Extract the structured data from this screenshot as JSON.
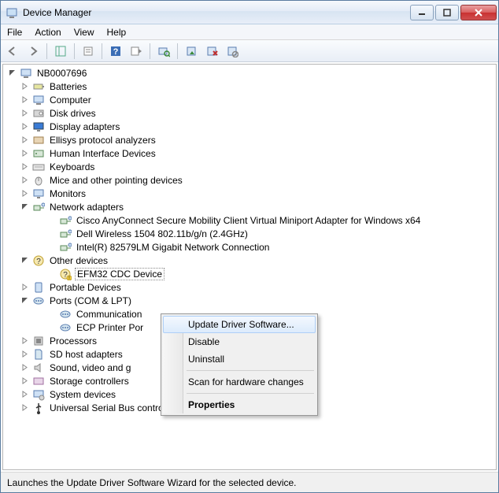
{
  "title": "Device Manager",
  "menubar": [
    "File",
    "Action",
    "View",
    "Help"
  ],
  "statusbar": "Launches the Update Driver Software Wizard for the selected device.",
  "root": "NB0007696",
  "categories": [
    {
      "label": "Batteries",
      "expanded": false,
      "hasChildren": true,
      "icon": "battery"
    },
    {
      "label": "Computer",
      "expanded": false,
      "hasChildren": true,
      "icon": "computer"
    },
    {
      "label": "Disk drives",
      "expanded": false,
      "hasChildren": true,
      "icon": "disk"
    },
    {
      "label": "Display adapters",
      "expanded": false,
      "hasChildren": true,
      "icon": "display"
    },
    {
      "label": "Ellisys protocol analyzers",
      "expanded": false,
      "hasChildren": true,
      "icon": "analyzer"
    },
    {
      "label": "Human Interface Devices",
      "expanded": false,
      "hasChildren": true,
      "icon": "hid"
    },
    {
      "label": "Keyboards",
      "expanded": false,
      "hasChildren": true,
      "icon": "keyboard"
    },
    {
      "label": "Mice and other pointing devices",
      "expanded": false,
      "hasChildren": true,
      "icon": "mouse"
    },
    {
      "label": "Monitors",
      "expanded": false,
      "hasChildren": true,
      "icon": "monitor"
    },
    {
      "label": "Network adapters",
      "expanded": true,
      "hasChildren": true,
      "icon": "network",
      "children": [
        {
          "label": "Cisco AnyConnect Secure Mobility Client Virtual Miniport Adapter for Windows x64",
          "icon": "network"
        },
        {
          "label": "Dell Wireless 1504 802.11b/g/n (2.4GHz)",
          "icon": "network"
        },
        {
          "label": "Intel(R) 82579LM Gigabit Network Connection",
          "icon": "network"
        }
      ]
    },
    {
      "label": "Other devices",
      "expanded": true,
      "hasChildren": true,
      "icon": "other",
      "children": [
        {
          "label": "EFM32 CDC Device",
          "icon": "unknown",
          "selected": true
        }
      ]
    },
    {
      "label": "Portable Devices",
      "expanded": false,
      "hasChildren": true,
      "icon": "portable"
    },
    {
      "label": "Ports (COM & LPT)",
      "expanded": true,
      "hasChildren": true,
      "icon": "port",
      "children": [
        {
          "label": "Communication",
          "icon": "port",
          "truncated": true
        },
        {
          "label": "ECP Printer Por",
          "icon": "port",
          "truncated": true
        }
      ]
    },
    {
      "label": "Processors",
      "expanded": false,
      "hasChildren": true,
      "icon": "cpu"
    },
    {
      "label": "SD host adapters",
      "expanded": false,
      "hasChildren": true,
      "icon": "sd"
    },
    {
      "label": "Sound, video and g",
      "expanded": false,
      "hasChildren": true,
      "icon": "sound",
      "truncated": true
    },
    {
      "label": "Storage controllers",
      "expanded": false,
      "hasChildren": true,
      "icon": "storage"
    },
    {
      "label": "System devices",
      "expanded": false,
      "hasChildren": true,
      "icon": "system"
    },
    {
      "label": "Universal Serial Bus controllers",
      "expanded": false,
      "hasChildren": true,
      "icon": "usb"
    }
  ],
  "context_menu": {
    "items": [
      {
        "label": "Update Driver Software...",
        "hovered": true
      },
      {
        "label": "Disable"
      },
      {
        "label": "Uninstall"
      },
      {
        "sep": true
      },
      {
        "label": "Scan for hardware changes"
      },
      {
        "sep": true
      },
      {
        "label": "Properties",
        "bold": true
      }
    ]
  }
}
